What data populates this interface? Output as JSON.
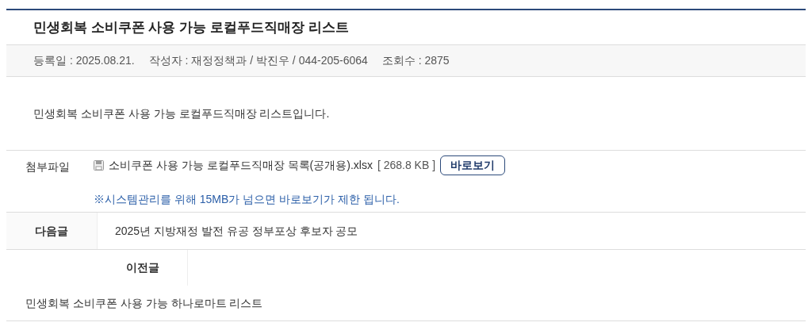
{
  "title": "민생회복 소비쿠폰 사용 가능 로컬푸드직매장 리스트",
  "meta": [
    "등록일 : 2025.08.21.",
    "작성자 : 재정정책과 / 박진우 / 044-205-6064",
    "조회수 : 2875"
  ],
  "body": "민생회복 소비쿠폰 사용 가능 로컬푸드직매장 리스트입니다.",
  "attachment": {
    "label": "첨부파일",
    "file": "소비쿠폰 사용 가능 로컬푸드직매장 목록(공개용).xlsx",
    "size": "[ 268.8 KB ]",
    "view_button": "바로보기",
    "notice": "※시스템관리를 위해 15MB가 넘으면 바로보기가 제한 됩니다."
  },
  "next": {
    "label": "다음글",
    "title": "2025년 지방재정 발전 유공 정부포상 후보자 공모"
  },
  "prev": {
    "label": "이전글",
    "title": "민생회복 소비쿠폰 사용 가능 하나로마트 리스트"
  }
}
